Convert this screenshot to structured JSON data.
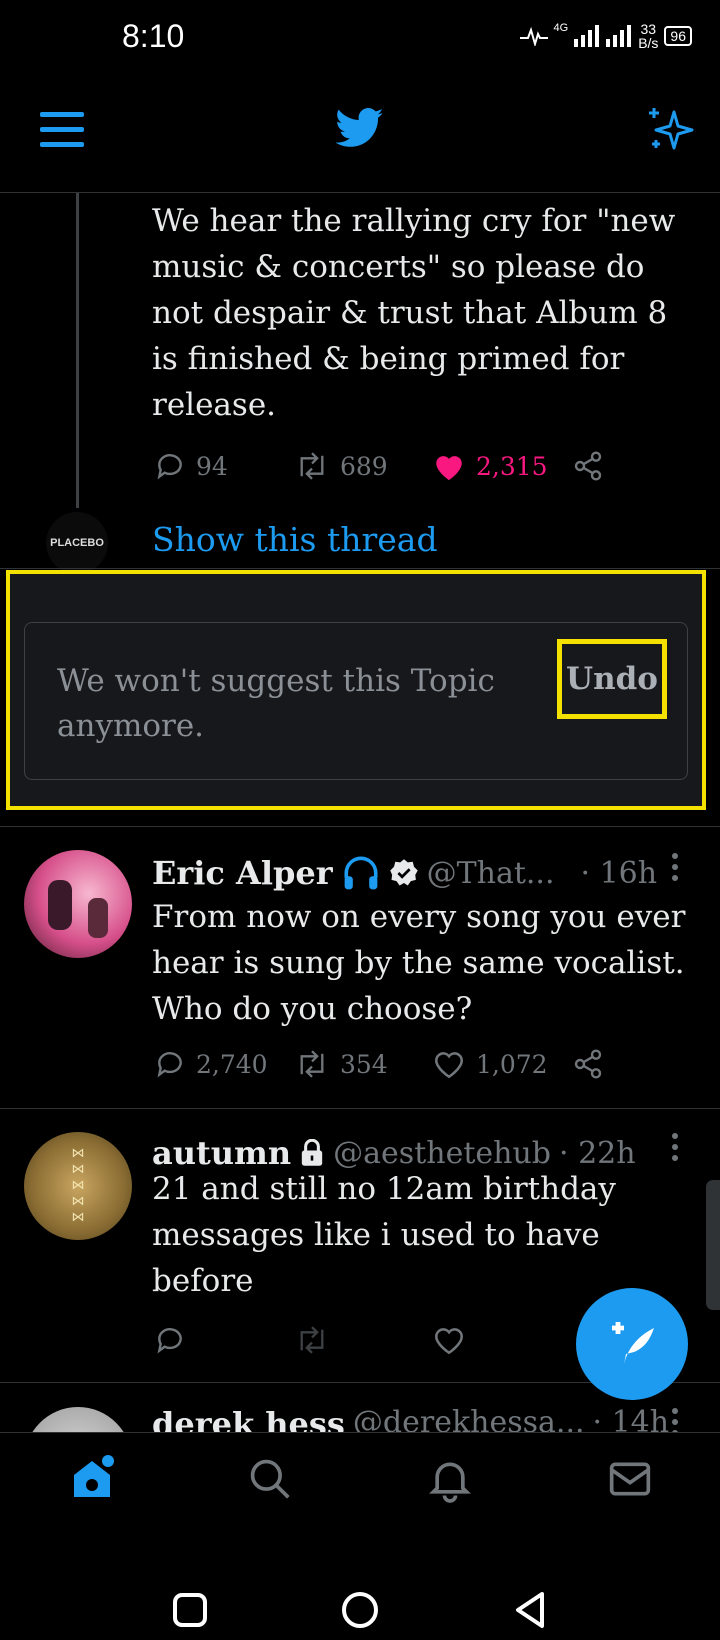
{
  "status": {
    "time": "8:10",
    "net": "4G",
    "speed_value": "33",
    "speed_unit": "B/s",
    "battery": "96"
  },
  "top": {
    "menu_icon": "menu-icon",
    "logo_icon": "twitter-bird-icon",
    "sparkle_icon": "sparkle-icon"
  },
  "thread_tweet": {
    "text": "We hear the rallying cry for \"new music & concerts\" so please do not despair & trust that Album 8 is finished & being primed for release.",
    "replies": "94",
    "retweets": "689",
    "likes": "2,315"
  },
  "show_thread": {
    "avatar_text": "PLACEBO",
    "link": "Show this thread"
  },
  "topic_notice": {
    "message": "We won't suggest this Topic anymore.",
    "undo": "Undo"
  },
  "tweets": [
    {
      "name": "Eric Alper",
      "handle": "@That...",
      "time": "· 16h",
      "text": "From now on every song you ever hear is sung by the same vocalist. Who do you choose?",
      "replies": "2,740",
      "retweets": "354",
      "likes": "1,072"
    },
    {
      "name": "autumn",
      "handle": "@aesthetehub",
      "time": "· 22h",
      "text": "21 and still no 12am birthday messages like i used to have before"
    },
    {
      "name": "derek hess",
      "handle": "@derekhessa...",
      "time": "· 14h"
    }
  ],
  "colors": {
    "accent": "#1d9bf0",
    "like": "#f91880",
    "highlight": "#f5e100",
    "muted": "#71767b"
  }
}
